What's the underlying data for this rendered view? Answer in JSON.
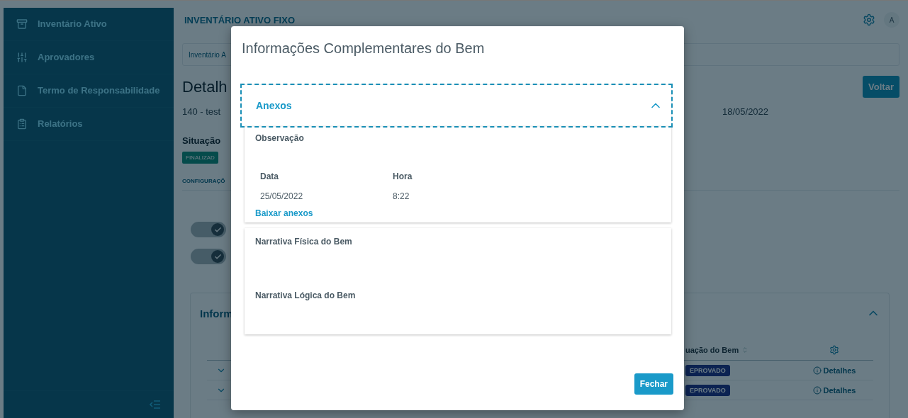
{
  "sidebar": {
    "items": [
      {
        "label": "Inventário Ativo"
      },
      {
        "label": "Aprovadores"
      },
      {
        "label": "Termo de Responsabilidade"
      },
      {
        "label": "Relatórios"
      }
    ]
  },
  "header": {
    "title": "INVENTÁRIO ATIVO FIXO",
    "avatar": "A"
  },
  "breadcrumb": "Inventário A",
  "page": {
    "title": "Detalh",
    "back_button": "Voltar",
    "code": "140 - test",
    "date": "18/05/2022",
    "status_label": "Situação",
    "status_badge": "FINALIZAD",
    "section_label": "CONFIGURAÇÕ",
    "toggles": [
      {
        "on": true
      },
      {
        "on": true
      }
    ]
  },
  "info_card": {
    "title": "Inform",
    "expanded": true,
    "columns": [
      "uação do Bem"
    ],
    "rows": [
      {
        "status": "EPROVADO",
        "action": "Detalhes"
      },
      {
        "status": "EPROVADO",
        "action": "Detalhes"
      }
    ]
  },
  "modal": {
    "title": "Informações Complementares do Bem",
    "accordion": {
      "title": "Anexos",
      "expanded": true,
      "focused": true,
      "observation_label": "Observação",
      "columns": [
        "Data",
        "Hora"
      ],
      "rows": [
        [
          "25/05/2022",
          "8:22"
        ]
      ],
      "link": "Baixar anexos"
    },
    "narratives": [
      "Narrativa Física do Bem",
      "Narrativa Lógica do Bem"
    ],
    "close_button": "Fechar"
  }
}
